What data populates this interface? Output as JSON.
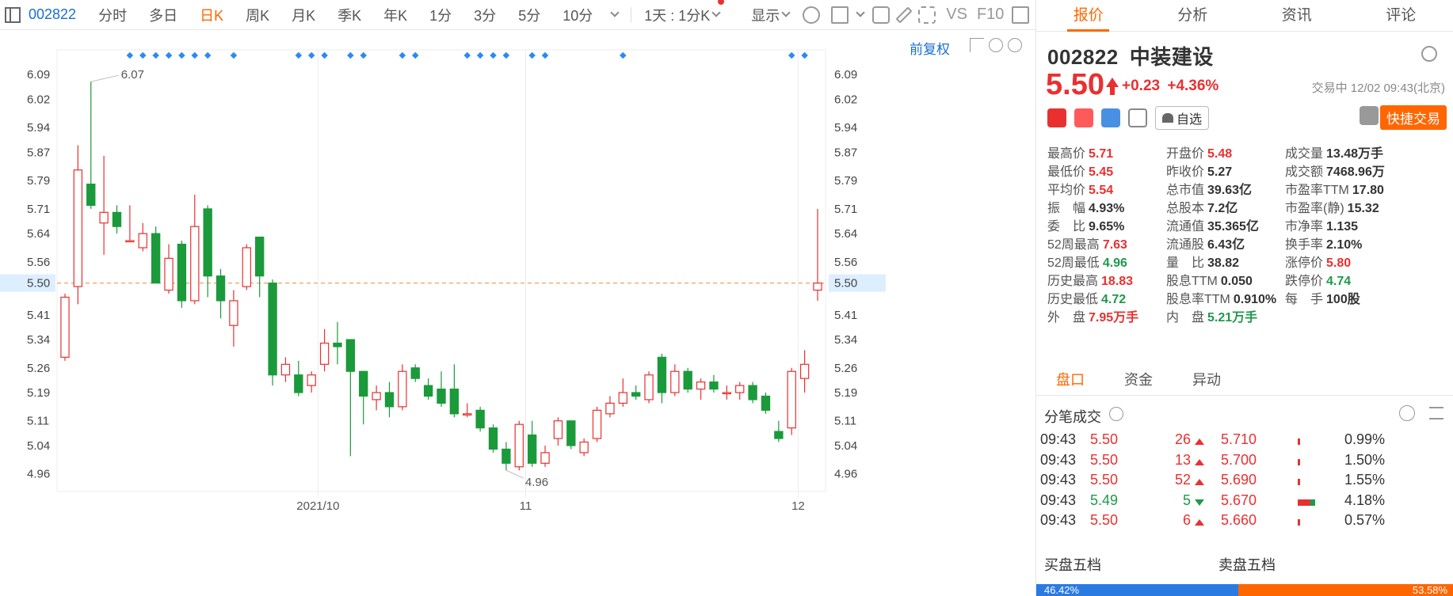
{
  "toolbar": {
    "code": "002822",
    "tabs": [
      "分时",
      "多日",
      "日K",
      "周K",
      "月K",
      "季K",
      "年K",
      "1分",
      "3分",
      "5分",
      "10分"
    ],
    "active_tab": "日K",
    "period_select": "1天 : 1分K",
    "display": "显示",
    "vs_label": "VS",
    "f10_label": "F10"
  },
  "chart_header": {
    "adjust": "前复权"
  },
  "chart_data": {
    "type": "candlestick",
    "title": "",
    "ylim": [
      4.91,
      6.16
    ],
    "y_ticks": [
      "6.09",
      "6.02",
      "5.94",
      "5.87",
      "5.79",
      "5.71",
      "5.64",
      "5.56",
      "5.50",
      "5.41",
      "5.34",
      "5.26",
      "5.19",
      "5.11",
      "5.04",
      "4.96"
    ],
    "y_tick_values": [
      6.09,
      6.02,
      5.94,
      5.87,
      5.79,
      5.71,
      5.64,
      5.56,
      5.5,
      5.41,
      5.34,
      5.26,
      5.19,
      5.11,
      5.04,
      4.96
    ],
    "x_labels": [
      {
        "label": "2021/10",
        "index": 20
      },
      {
        "label": "11",
        "index": 36
      },
      {
        "label": "12",
        "index": 57
      }
    ],
    "current_price": 5.5,
    "max_label": "6.07",
    "min_label": "4.96",
    "candles": [
      {
        "o": 5.29,
        "c": 5.46,
        "h": 5.47,
        "l": 5.28
      },
      {
        "o": 5.49,
        "c": 5.82,
        "h": 5.89,
        "l": 5.44
      },
      {
        "o": 5.78,
        "c": 5.72,
        "h": 6.07,
        "l": 5.71
      },
      {
        "o": 5.67,
        "c": 5.7,
        "h": 5.86,
        "l": 5.58
      },
      {
        "o": 5.7,
        "c": 5.66,
        "h": 5.72,
        "l": 5.64
      },
      {
        "o": 5.62,
        "c": 5.62,
        "h": 5.72,
        "l": 5.62
      },
      {
        "o": 5.6,
        "c": 5.64,
        "h": 5.67,
        "l": 5.59
      },
      {
        "o": 5.64,
        "c": 5.5,
        "h": 5.66,
        "l": 5.5
      },
      {
        "o": 5.48,
        "c": 5.57,
        "h": 5.61,
        "l": 5.47
      },
      {
        "o": 5.61,
        "c": 5.45,
        "h": 5.62,
        "l": 5.43
      },
      {
        "o": 5.45,
        "c": 5.66,
        "h": 5.75,
        "l": 5.44
      },
      {
        "o": 5.71,
        "c": 5.52,
        "h": 5.72,
        "l": 5.46
      },
      {
        "o": 5.52,
        "c": 5.45,
        "h": 5.54,
        "l": 5.4
      },
      {
        "o": 5.38,
        "c": 5.45,
        "h": 5.48,
        "l": 5.32
      },
      {
        "o": 5.49,
        "c": 5.6,
        "h": 5.61,
        "l": 5.48
      },
      {
        "o": 5.63,
        "c": 5.52,
        "h": 5.63,
        "l": 5.46
      },
      {
        "o": 5.5,
        "c": 5.24,
        "h": 5.51,
        "l": 5.21
      },
      {
        "o": 5.24,
        "c": 5.27,
        "h": 5.29,
        "l": 5.22
      },
      {
        "o": 5.24,
        "c": 5.19,
        "h": 5.28,
        "l": 5.18
      },
      {
        "o": 5.21,
        "c": 5.24,
        "h": 5.25,
        "l": 5.19
      },
      {
        "o": 5.27,
        "c": 5.33,
        "h": 5.37,
        "l": 5.25
      },
      {
        "o": 5.33,
        "c": 5.32,
        "h": 5.39,
        "l": 5.27
      },
      {
        "o": 5.34,
        "c": 5.25,
        "h": 5.34,
        "l": 5.01
      },
      {
        "o": 5.25,
        "c": 5.18,
        "h": 5.25,
        "l": 5.1
      },
      {
        "o": 5.17,
        "c": 5.19,
        "h": 5.21,
        "l": 5.14
      },
      {
        "o": 5.19,
        "c": 5.15,
        "h": 5.22,
        "l": 5.12
      },
      {
        "o": 5.15,
        "c": 5.25,
        "h": 5.27,
        "l": 5.14
      },
      {
        "o": 5.26,
        "c": 5.23,
        "h": 5.27,
        "l": 5.22
      },
      {
        "o": 5.21,
        "c": 5.18,
        "h": 5.23,
        "l": 5.17
      },
      {
        "o": 5.2,
        "c": 5.16,
        "h": 5.25,
        "l": 5.15
      },
      {
        "o": 5.2,
        "c": 5.13,
        "h": 5.27,
        "l": 5.12
      },
      {
        "o": 5.13,
        "c": 5.13,
        "h": 5.16,
        "l": 5.12
      },
      {
        "o": 5.14,
        "c": 5.09,
        "h": 5.15,
        "l": 5.08
      },
      {
        "o": 5.09,
        "c": 5.03,
        "h": 5.1,
        "l": 5.02
      },
      {
        "o": 5.03,
        "c": 4.99,
        "h": 5.05,
        "l": 4.97
      },
      {
        "o": 4.98,
        "c": 5.1,
        "h": 5.11,
        "l": 4.97
      },
      {
        "o": 5.07,
        "c": 4.99,
        "h": 5.11,
        "l": 4.98
      },
      {
        "o": 4.99,
        "c": 5.02,
        "h": 5.04,
        "l": 4.98
      },
      {
        "o": 5.06,
        "c": 5.11,
        "h": 5.12,
        "l": 5.04
      },
      {
        "o": 5.11,
        "c": 5.04,
        "h": 5.11,
        "l": 5.03
      },
      {
        "o": 5.02,
        "c": 5.05,
        "h": 5.06,
        "l": 5.01
      },
      {
        "o": 5.06,
        "c": 5.14,
        "h": 5.15,
        "l": 5.05
      },
      {
        "o": 5.13,
        "c": 5.16,
        "h": 5.18,
        "l": 5.12
      },
      {
        "o": 5.16,
        "c": 5.19,
        "h": 5.23,
        "l": 5.15
      },
      {
        "o": 5.19,
        "c": 5.18,
        "h": 5.21,
        "l": 5.17
      },
      {
        "o": 5.17,
        "c": 5.24,
        "h": 5.25,
        "l": 5.16
      },
      {
        "o": 5.29,
        "c": 5.19,
        "h": 5.3,
        "l": 5.16
      },
      {
        "o": 5.19,
        "c": 5.25,
        "h": 5.27,
        "l": 5.18
      },
      {
        "o": 5.25,
        "c": 5.2,
        "h": 5.26,
        "l": 5.19
      },
      {
        "o": 5.2,
        "c": 5.22,
        "h": 5.23,
        "l": 5.17
      },
      {
        "o": 5.22,
        "c": 5.2,
        "h": 5.24,
        "l": 5.19
      },
      {
        "o": 5.19,
        "c": 5.19,
        "h": 5.21,
        "l": 5.17
      },
      {
        "o": 5.19,
        "c": 5.21,
        "h": 5.22,
        "l": 5.17
      },
      {
        "o": 5.21,
        "c": 5.17,
        "h": 5.22,
        "l": 5.16
      },
      {
        "o": 5.18,
        "c": 5.14,
        "h": 5.19,
        "l": 5.13
      },
      {
        "o": 5.08,
        "c": 5.06,
        "h": 5.11,
        "l": 5.05
      },
      {
        "o": 5.09,
        "c": 5.25,
        "h": 5.26,
        "l": 5.07
      },
      {
        "o": 5.23,
        "c": 5.27,
        "h": 5.31,
        "l": 5.19
      },
      {
        "o": 5.48,
        "c": 5.5,
        "h": 5.71,
        "l": 5.45
      }
    ],
    "marker_indices": [
      5,
      6,
      7,
      8,
      9,
      10,
      11,
      13,
      18,
      19,
      20,
      22,
      23,
      26,
      27,
      31,
      32,
      33,
      34,
      36,
      37,
      43,
      56,
      57
    ]
  },
  "panel": {
    "tabs": [
      "报价",
      "分析",
      "资讯",
      "评论"
    ],
    "active_tab": "报价",
    "code": "002822",
    "name": "中装建设",
    "price": "5.50",
    "change": "+0.23",
    "change_pct": "+4.36%",
    "status": "交易中 12/02 09:43(北京)",
    "watch_label": "自选",
    "quick_trade": "快捷交易",
    "stats": [
      {
        "label": "最高价",
        "value": "5.71",
        "color": "r"
      },
      {
        "label": "开盘价",
        "value": "5.48",
        "color": "r"
      },
      {
        "label": "成交量",
        "value": "13.48万手",
        "color": ""
      },
      {
        "label": "最低价",
        "value": "5.45",
        "color": "r"
      },
      {
        "label": "昨收价",
        "value": "5.27",
        "color": ""
      },
      {
        "label": "成交额",
        "value": "7468.96万",
        "color": ""
      },
      {
        "label": "平均价",
        "value": "5.54",
        "color": "r"
      },
      {
        "label": "总市值",
        "value": "39.63亿",
        "color": ""
      },
      {
        "label": "市盈率TTM",
        "value": "17.80",
        "color": ""
      },
      {
        "label": "振　幅",
        "value": "4.93%",
        "color": ""
      },
      {
        "label": "总股本",
        "value": "7.2亿",
        "color": ""
      },
      {
        "label": "市盈率(静)",
        "value": "15.32",
        "color": ""
      },
      {
        "label": "委　比",
        "value": "9.65%",
        "color": ""
      },
      {
        "label": "流通值",
        "value": "35.365亿",
        "color": ""
      },
      {
        "label": "市净率",
        "value": "1.135",
        "color": ""
      },
      {
        "label": "52周最高",
        "value": "7.63",
        "color": "r"
      },
      {
        "label": "流通股",
        "value": "6.43亿",
        "color": ""
      },
      {
        "label": "换手率",
        "value": "2.10%",
        "color": ""
      },
      {
        "label": "52周最低",
        "value": "4.96",
        "color": "g"
      },
      {
        "label": "量　比",
        "value": "38.82",
        "color": ""
      },
      {
        "label": "涨停价",
        "value": "5.80",
        "color": "r"
      },
      {
        "label": "历史最高",
        "value": "18.83",
        "color": "r"
      },
      {
        "label": "股息TTM",
        "value": "0.050",
        "color": ""
      },
      {
        "label": "跌停价",
        "value": "4.74",
        "color": "g"
      },
      {
        "label": "历史最低",
        "value": "4.72",
        "color": "g"
      },
      {
        "label": "股息率TTM",
        "value": "0.910%",
        "color": ""
      },
      {
        "label": "每　手",
        "value": "100股",
        "color": ""
      },
      {
        "label": "外　盘",
        "value": "7.95万手",
        "color": "r"
      },
      {
        "label": "内　盘",
        "value": "5.21万手",
        "color": "g"
      }
    ],
    "subtabs": [
      "盘口",
      "资金",
      "异动"
    ],
    "active_subtab": "盘口",
    "ticks_title": "分笔成交",
    "ticks": [
      {
        "time": "09:43",
        "price": "5.50",
        "vol": "26",
        "dir": "up"
      },
      {
        "time": "09:43",
        "price": "5.50",
        "vol": "13",
        "dir": "up"
      },
      {
        "time": "09:43",
        "price": "5.50",
        "vol": "52",
        "dir": "up"
      },
      {
        "time": "09:43",
        "price": "5.49",
        "vol": "5",
        "dir": "down"
      },
      {
        "time": "09:43",
        "price": "5.50",
        "vol": "6",
        "dir": "up"
      }
    ],
    "price_dist": [
      {
        "price": "5.710",
        "pct": "0.99%",
        "ratio": 0.05
      },
      {
        "price": "5.700",
        "pct": "1.50%",
        "ratio": 0.08
      },
      {
        "price": "5.690",
        "pct": "1.55%",
        "ratio": 0.08
      },
      {
        "price": "5.670",
        "pct": "4.18%",
        "ratio": 1.0
      },
      {
        "price": "5.660",
        "pct": "0.57%",
        "ratio": 0.03
      }
    ],
    "buy_five": "买盘五档",
    "sell_five": "卖盘五档",
    "buy_pct": "46.42%",
    "sell_pct": "53.58%"
  }
}
